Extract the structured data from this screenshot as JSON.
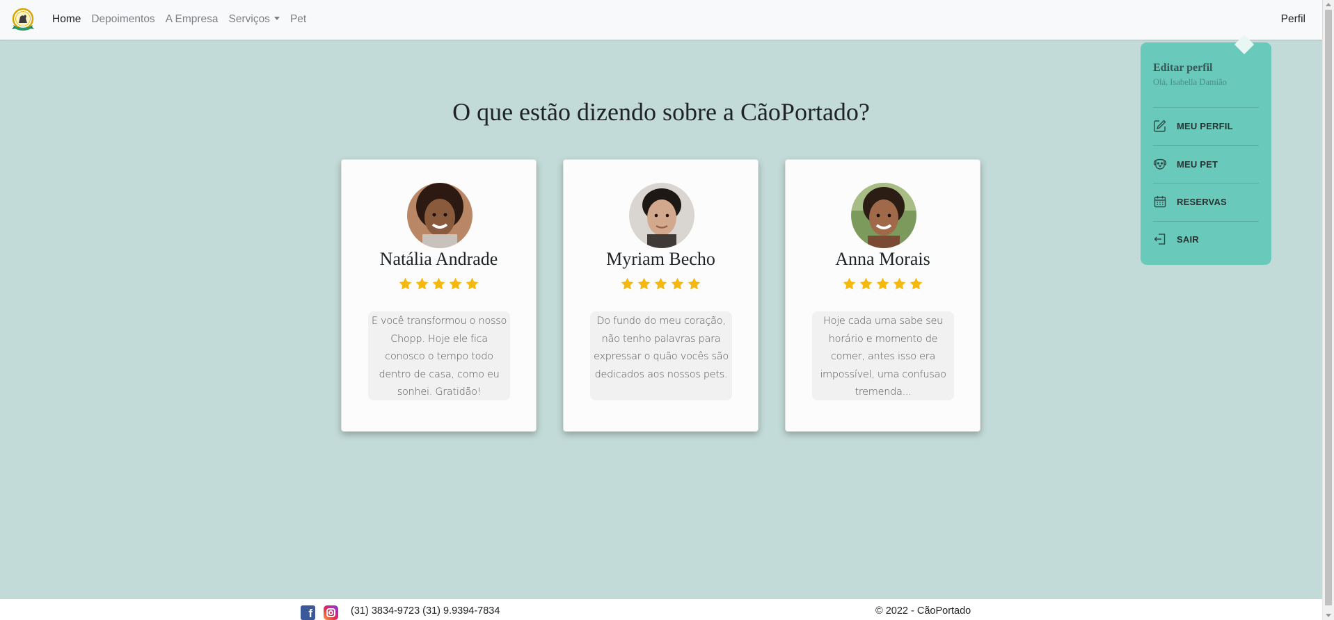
{
  "navbar": {
    "logo_icon": "caoportado-dog-logo-icon",
    "links": [
      {
        "label": "Home",
        "active": true
      },
      {
        "label": "Depoimentos",
        "active": false
      },
      {
        "label": "A Empresa",
        "active": false
      },
      {
        "label": "Serviços",
        "active": false,
        "dropdown": true
      },
      {
        "label": "Pet",
        "active": false
      }
    ],
    "profile_label": "Perfil"
  },
  "main": {
    "title": "O que estão dizendo sobre a CãoPortado?"
  },
  "testimonials": [
    {
      "name": "Natália Andrade",
      "rating": 5,
      "quote": "E você transformou o nosso Chopp. Hoje ele fica conosco o tempo todo dentro de casa, como eu sonhei. Gratidão!"
    },
    {
      "name": "Myriam Becho",
      "rating": 5,
      "quote": "Do fundo do meu coração, não tenho palavras para expressar o quão vocês são dedicados aos nossos pets."
    },
    {
      "name": "Anna Morais",
      "rating": 5,
      "quote": "Hoje cada uma sabe seu horário e momento de comer, antes isso era impossível, uma confusao tremenda..."
    }
  ],
  "profile_menu": {
    "title": "Editar perfil",
    "greeting": "Olá, Isabella Damião",
    "items": [
      {
        "label": "MEU PERFIL",
        "icon": "edit-icon"
      },
      {
        "label": "MEU PET",
        "icon": "dog-face-icon"
      },
      {
        "label": "RESERVAS",
        "icon": "calendar-icon"
      },
      {
        "label": "SAIR",
        "icon": "logout-icon"
      }
    ]
  },
  "footer": {
    "phones": "(31) 3834-9723 (31) 9.9394-7834",
    "copyright": "© 2022 - CãoPortado"
  },
  "colors": {
    "page_background": "#c3dbd8",
    "menu_background": "#69c9bb",
    "star": "#f5b80f",
    "navbar": "#f8f9fa"
  }
}
